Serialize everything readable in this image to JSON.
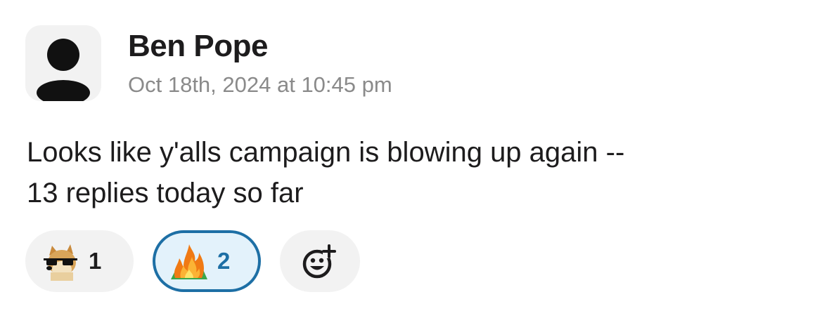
{
  "message": {
    "author": "Ben Pope",
    "timestamp": "Oct 18th, 2024 at 10:45 pm",
    "text_line1": "Looks like y'alls campaign is blowing up again --",
    "text_line2": "13 replies today so far"
  },
  "reactions": [
    {
      "emoji": "doge-sunglasses-emoji",
      "count": "1",
      "selected": false
    },
    {
      "emoji": "fire-emoji",
      "count": "2",
      "selected": true
    }
  ],
  "add_reaction": {
    "icon": "add-reaction-icon"
  },
  "colors": {
    "selected_border": "#1d6fa5",
    "selected_bg": "#e3f2fb",
    "chip_bg": "#f2f2f2",
    "timestamp": "#8a8a8a"
  }
}
